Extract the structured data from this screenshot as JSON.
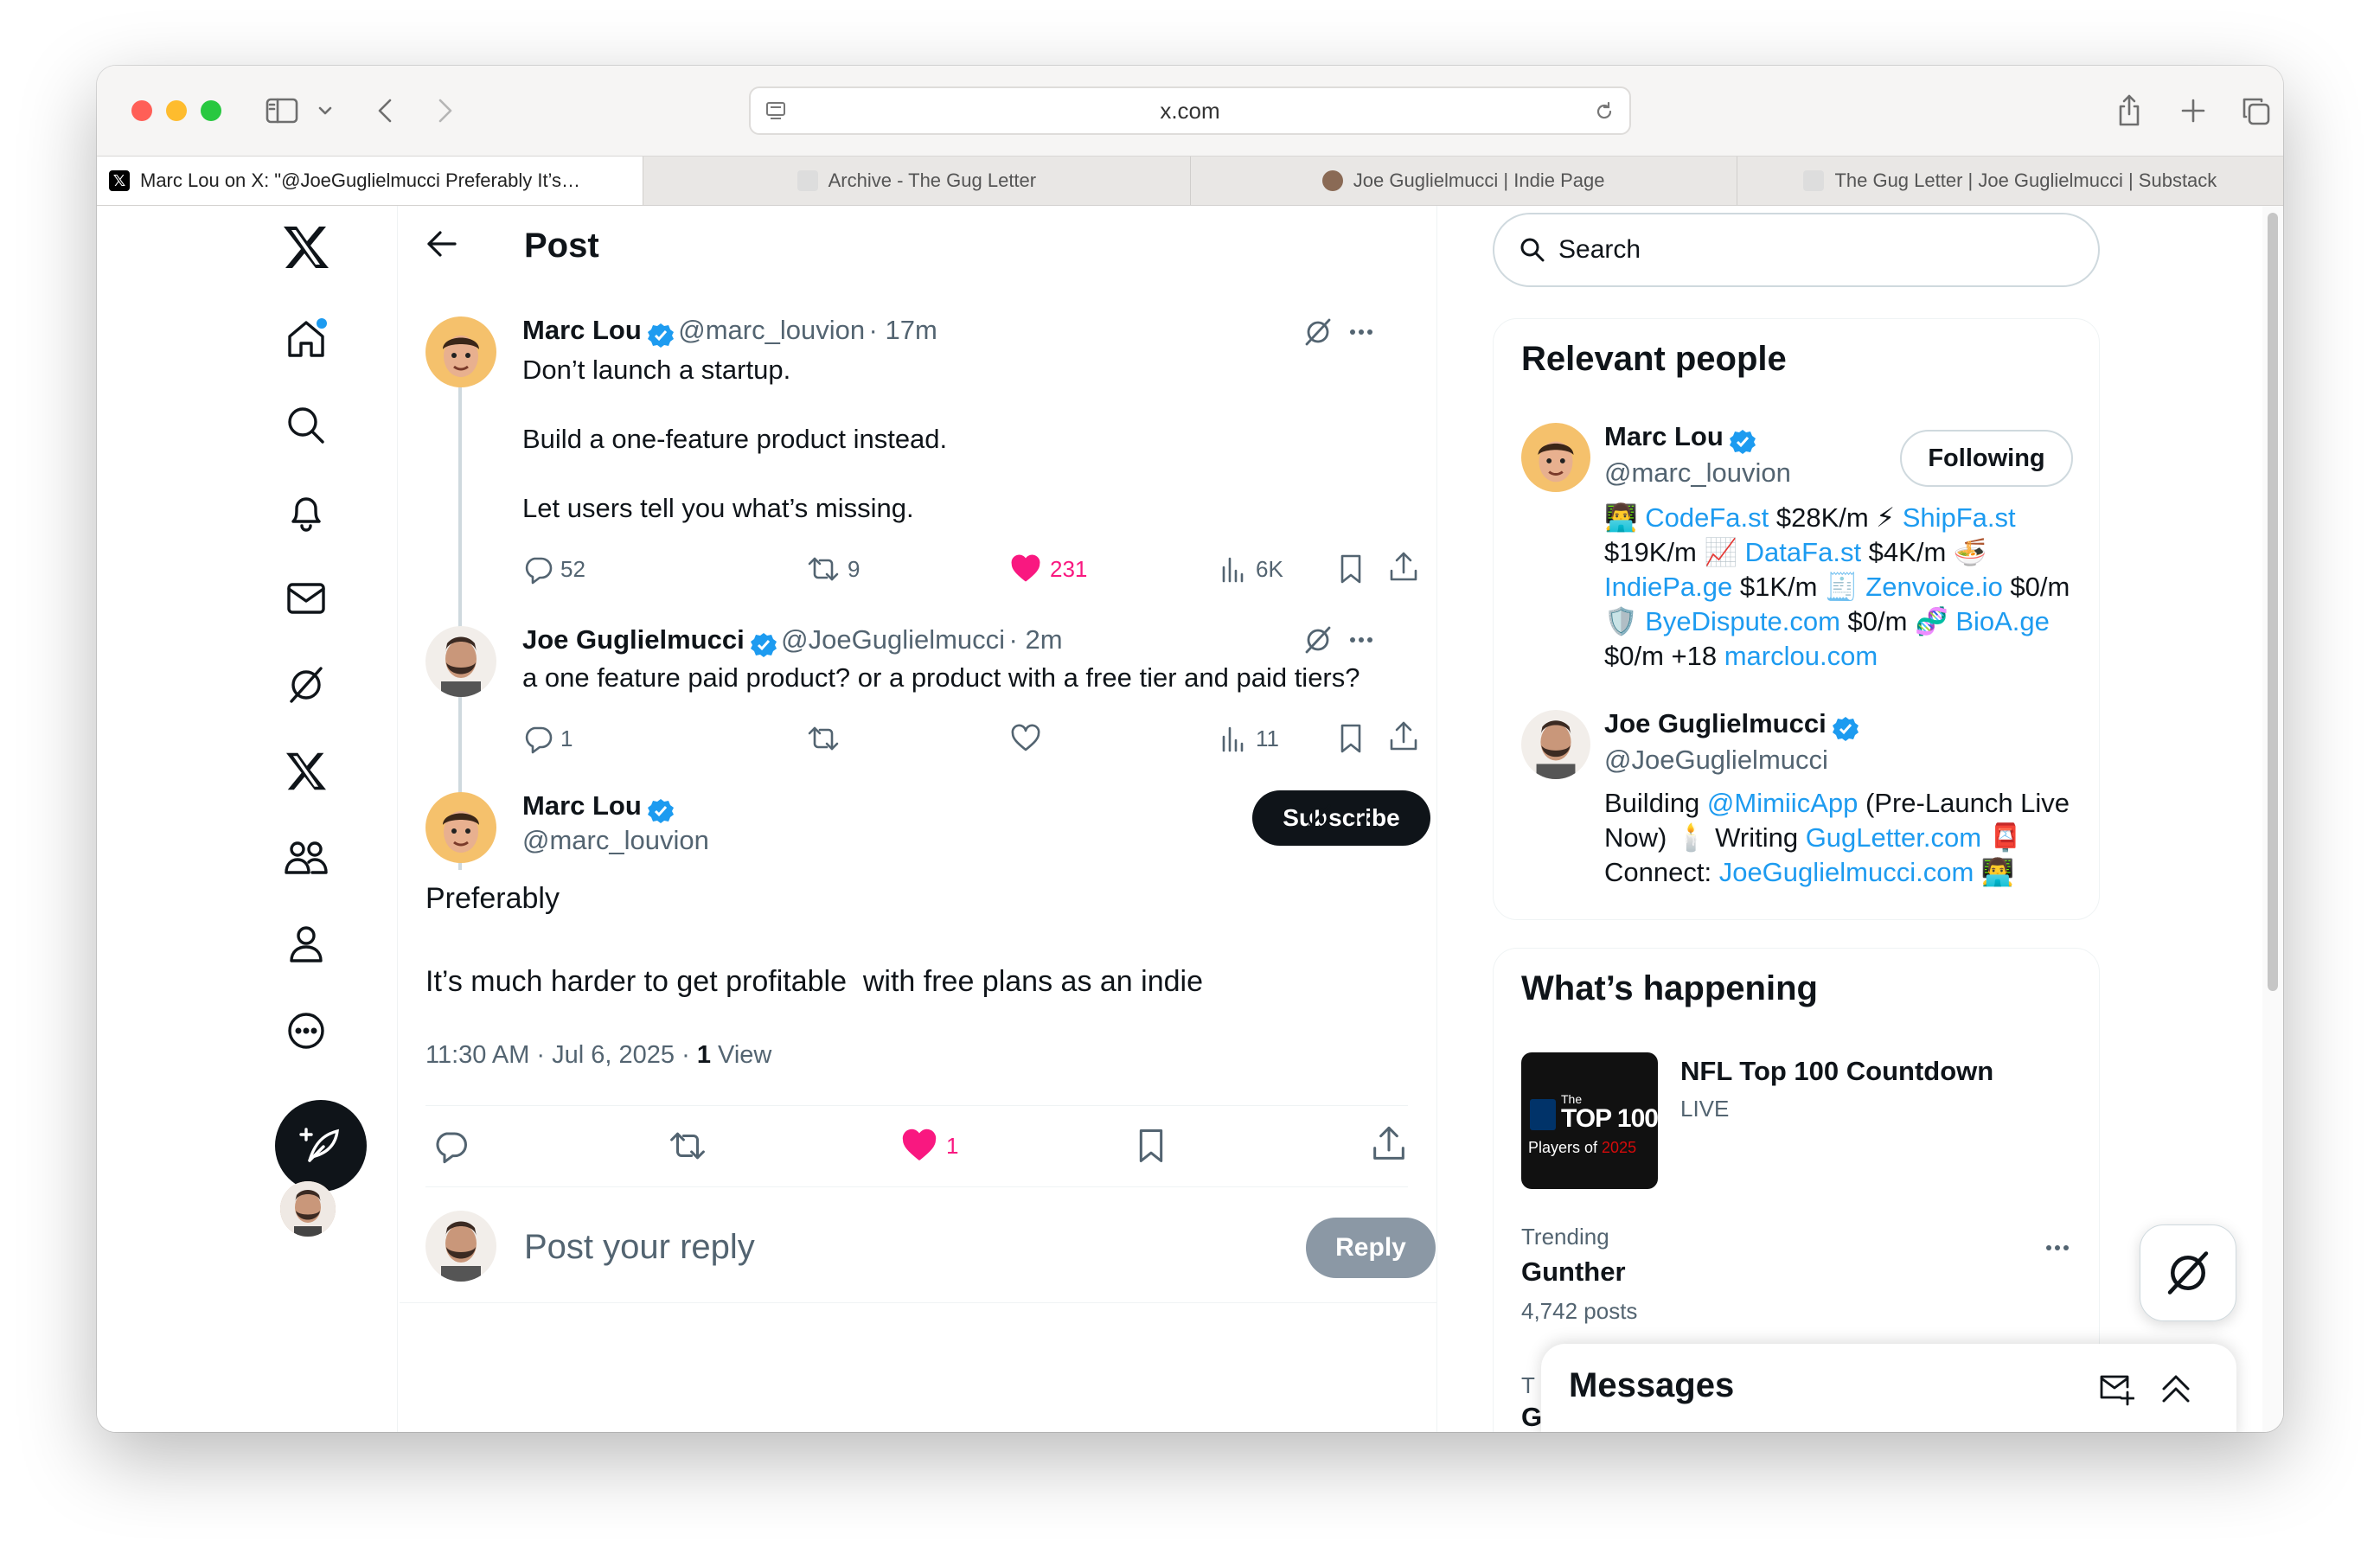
{
  "browser": {
    "address": "x.com",
    "tabs": [
      {
        "label": "Marc Lou on X: \"@JoeGuglielmucci Preferably It’s…",
        "icon": "x-logo-icon",
        "active": true
      },
      {
        "label": "Archive - The Gug Letter",
        "icon": "substack-favicon-icon"
      },
      {
        "label": "Joe Guglielmucci | Indie Page",
        "icon": "profile-favicon-icon"
      },
      {
        "label": "The Gug Letter | Joe Guglielmucci | Substack",
        "icon": "substack-favicon-icon"
      }
    ]
  },
  "header": {
    "title": "Post"
  },
  "tweets": [
    {
      "name": "Marc Lou",
      "handle": "@marc_louvion",
      "time": "· 17m",
      "lines": [
        "Don’t launch a startup.",
        "Build a one-feature product instead.",
        "Let users tell you what’s missing."
      ],
      "replies": "52",
      "reposts": "9",
      "likes": "231",
      "views": "6K",
      "liked": true
    },
    {
      "name": "Joe Guglielmucci",
      "handle": "@JoeGuglielmucci",
      "time": "· 2m",
      "lines": [
        "a one feature paid product? or a product with a free tier and paid tiers?"
      ],
      "replies": "1",
      "reposts": "",
      "likes": "",
      "views": "11",
      "liked": false
    }
  ],
  "focus": {
    "name": "Marc Lou",
    "handle": "@marc_louvion",
    "subscribe_label": "Subscribe",
    "line1": "Preferably",
    "line2": "It’s much harder to get profitable  with free plans as an indie",
    "timestamp": "11:30 AM · Jul 6, 2025 ·",
    "views_count": "1",
    "views_label": "View",
    "likes": "1"
  },
  "reply": {
    "placeholder": "Post your reply",
    "button": "Reply"
  },
  "search": {
    "placeholder": "Search"
  },
  "relevant": {
    "title": "Relevant people",
    "people": [
      {
        "name": "Marc Lou",
        "handle": "@marc_louvion",
        "follow_label": "Following",
        "bio": {
          "l1a": "CodeFa.st",
          "l1b": " $28K/m ",
          "l1c": "ShipFa.st",
          "l2a": "$19K/m ",
          "l2b": "DataFa.st",
          "l2c": " $4K/m ",
          "l3a": "IndiePa.ge",
          "l3b": " $1K/m ",
          "l3c": "Zenvoice.io",
          "l3d": " $0/m",
          "l4a": "ByeDispute.com",
          "l4b": " $0/m ",
          "l4c": "BioA.ge",
          "l5a": "$0/m +18 ",
          "l5b": "marclou.com"
        }
      },
      {
        "name": "Joe Guglielmucci",
        "handle": "@JoeGuglielmucci",
        "bio": {
          "l1a": "Building ",
          "l1b": "@MimiicApp",
          "l1c": " (Pre-Launch Live",
          "l2a": "Now) ",
          "l2b": " Writing ",
          "l2c": "GugLetter.com",
          "l3a": "Connect: ",
          "l3b": "JoeGuglielmucci.com"
        }
      }
    ]
  },
  "happening": {
    "title": "What’s happening",
    "event": {
      "title": "NFL Top 100 Countdown",
      "status": "LIVE",
      "thumb_line1": "The",
      "thumb_line2": "TOP 100",
      "thumb_line3a": "Players of ",
      "thumb_line3b": "2025"
    },
    "trend": {
      "label": "Trending",
      "name": "Gunther",
      "posts": "4,742 posts"
    },
    "cut_label": "T",
    "cut_name": "G"
  },
  "messages": {
    "title": "Messages"
  },
  "colors": {
    "accent": "#1d9bf0",
    "like": "#f91880",
    "text": "#0f1419",
    "muted": "#536471"
  }
}
